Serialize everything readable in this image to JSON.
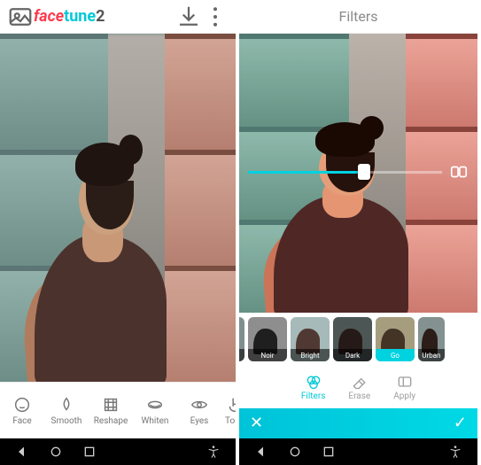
{
  "left": {
    "brand": {
      "face": "face",
      "tune": "tune",
      "two": "2"
    },
    "tools": [
      {
        "key": "face",
        "label": "Face"
      },
      {
        "key": "smooth",
        "label": "Smooth"
      },
      {
        "key": "reshape",
        "label": "Reshape"
      },
      {
        "key": "whiten",
        "label": "Whiten"
      },
      {
        "key": "eyes",
        "label": "Eyes"
      },
      {
        "key": "touch",
        "label": "Touc"
      }
    ]
  },
  "right": {
    "title": "Filters",
    "slider_percent": 60,
    "thumbs": [
      {
        "key": "le",
        "label": "le",
        "selected": false
      },
      {
        "key": "noir",
        "label": "Noir",
        "selected": false
      },
      {
        "key": "bright",
        "label": "Bright",
        "selected": false
      },
      {
        "key": "dark",
        "label": "Dark",
        "selected": false
      },
      {
        "key": "gold",
        "label": "Go",
        "selected": true
      },
      {
        "key": "urban",
        "label": "Urban",
        "selected": false
      }
    ],
    "actions": [
      {
        "key": "filters",
        "label": "Filters",
        "active": true
      },
      {
        "key": "erase",
        "label": "Erase",
        "active": false
      },
      {
        "key": "apply",
        "label": "Apply",
        "active": false
      }
    ]
  },
  "colors": {
    "accent": "#00c9d6",
    "brand_red": "#ff3a4e"
  }
}
